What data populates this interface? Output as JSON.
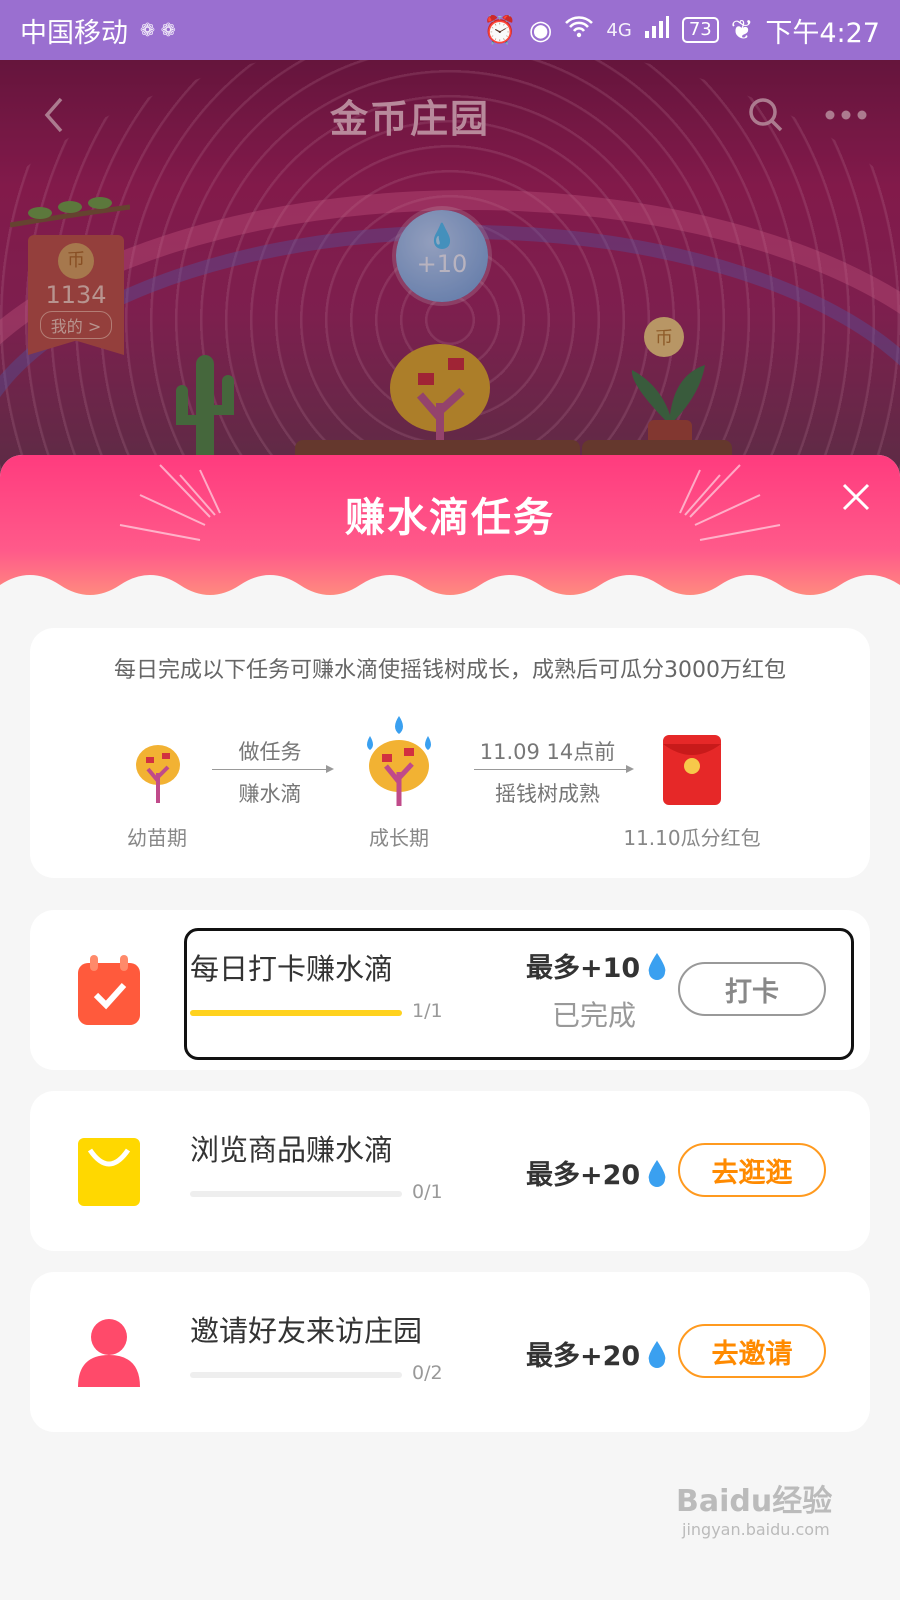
{
  "status_bar": {
    "carrier": "中国移动",
    "network": "4G",
    "battery": "73",
    "time": "下午4:27"
  },
  "header": {
    "title": "金币庄园",
    "back_icon": "chevron-left-icon",
    "search_icon": "search-icon",
    "more_icon": "more-icon"
  },
  "coin_badge": {
    "coin_glyph": "币",
    "amount": "1134",
    "mine_link": "我的 >"
  },
  "water_bubble": {
    "label": "+10"
  },
  "plant_coin": {
    "glyph": "币"
  },
  "task_sheet": {
    "title": "赚水滴任务",
    "close_icon": "close-icon",
    "intro": {
      "description": "每日完成以下任务可赚水滴使摇钱树成长，成熟后可瓜分3000万红包",
      "stages": [
        {
          "label": "幼苗期",
          "icon": "sapling-icon"
        },
        {
          "label": "成长期",
          "icon": "growing-tree-icon"
        },
        {
          "label": "11.10瓜分红包",
          "icon": "red-envelope-icon"
        }
      ],
      "steps": [
        {
          "top": "做任务",
          "bottom": "赚水滴"
        },
        {
          "top": "11.09 14点前",
          "bottom": "摇钱树成熟"
        }
      ]
    },
    "tasks": [
      {
        "name": "每日打卡赚水滴",
        "progress_text": "1/1",
        "progress": 1.0,
        "reward": "最多+10",
        "status": "已完成",
        "button": "打卡",
        "icon": "calendar-check-icon"
      },
      {
        "name": "浏览商品赚水滴",
        "progress_text": "0/1",
        "progress": 0.0,
        "reward": "最多+20",
        "status": "",
        "button": "去逛逛",
        "icon": "shopping-bag-icon"
      },
      {
        "name": "邀请好友来访庄园",
        "progress_text": "0/2",
        "progress": 0.0,
        "reward": "最多+20",
        "status": "",
        "button": "去邀请",
        "icon": "user-icon"
      }
    ]
  },
  "watermark": {
    "brand": "Baidu经验",
    "url": "jingyan.baidu.com"
  },
  "colors": {
    "status_bar": "#9a6fd0",
    "sheet_header": "#ff3b7e",
    "progress": "#ffd21e",
    "action_orange": "#ff8a00",
    "water_blue": "#3aa0f0"
  }
}
